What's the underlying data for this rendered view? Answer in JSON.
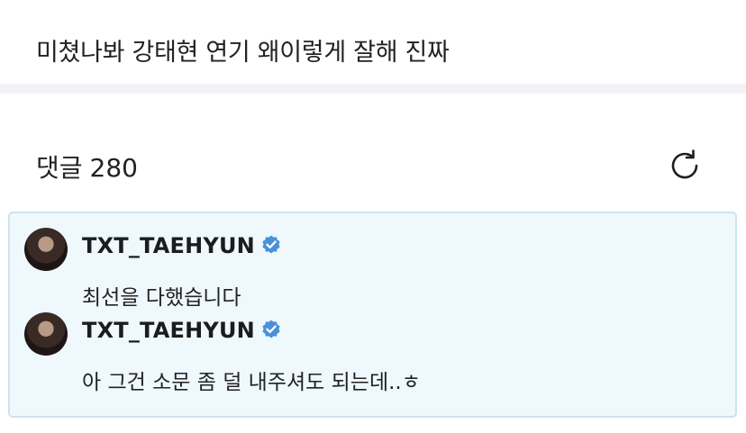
{
  "post": {
    "text": "미쳤나봐 강태현 연기 왜이렇게 잘해 진짜"
  },
  "comments_header": {
    "label": "댓글",
    "count": "280",
    "refresh_icon": "refresh-icon"
  },
  "comments": [
    {
      "username": "TXT_TAEHYUN",
      "verified": true,
      "text": "최선을 다했습니다"
    },
    {
      "username": "TXT_TAEHYUN",
      "verified": true,
      "text": "아 그건 소문 좀 덜 내주셔도 되는데..ㅎ"
    }
  ],
  "colors": {
    "highlight_bg": "#eef8fd",
    "highlight_border": "#cde3ef",
    "verified_blue": "#4a90d9"
  }
}
